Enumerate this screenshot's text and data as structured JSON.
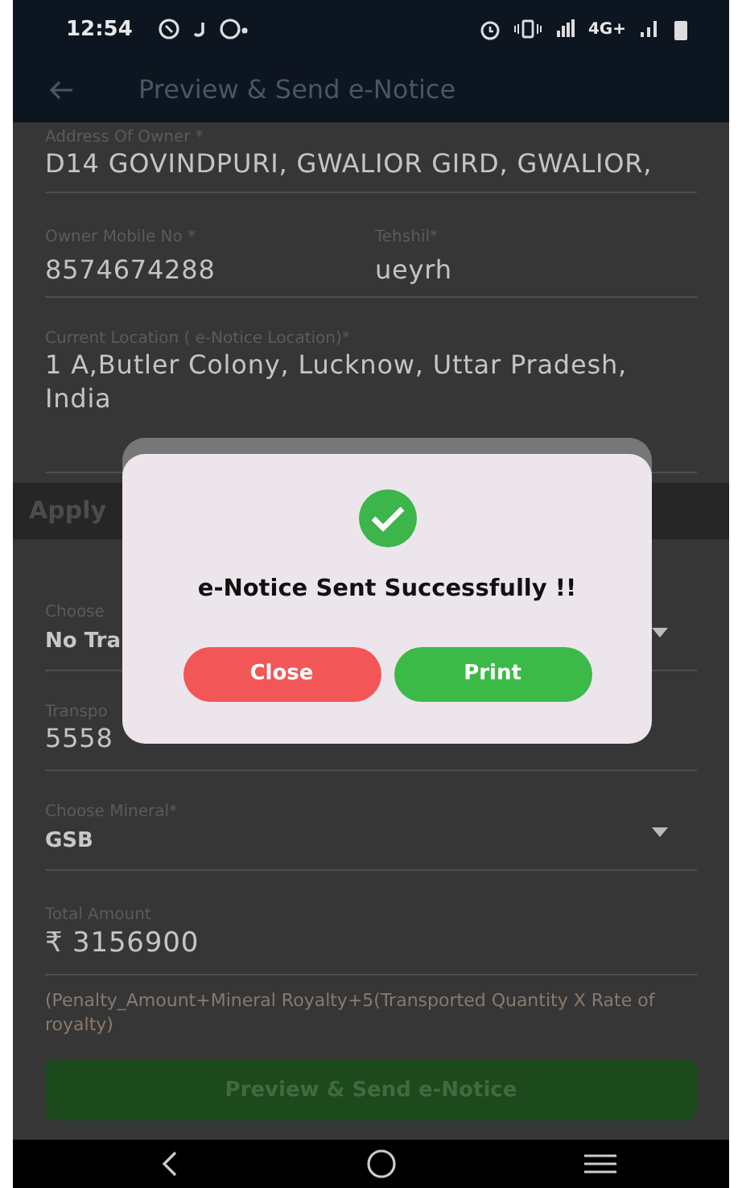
{
  "status_bar": {
    "time": "12:54",
    "network": "4G+"
  },
  "app_bar": {
    "title": "Preview & Send e-Notice"
  },
  "owner_fields": [
    {
      "kind": "text",
      "label": "Address Of Owner *",
      "value": "D14 GOVINDPURI, GWALIOR GIRD, GWALIOR,"
    },
    {
      "kind": "pair",
      "items": [
        {
          "label": "Owner Mobile No *",
          "value": "8574674288"
        },
        {
          "label": "Tehshil*",
          "value": "ueyrh"
        }
      ]
    },
    {
      "kind": "tall",
      "label": "Current Location ( e-Notice Location)*",
      "value": "1 A,Butler Colony, Lucknow, Uttar Pradesh, India"
    }
  ],
  "section": {
    "title": "Apply"
  },
  "violation_fields": [
    {
      "kind": "select",
      "label": "Choose",
      "value": "No Tra"
    },
    {
      "kind": "text",
      "label": "Transpo",
      "value": "5558"
    },
    {
      "kind": "select",
      "label": "Choose Mineral*",
      "value": "GSB"
    },
    {
      "kind": "amount",
      "label": "Total Amount",
      "value": "₹ 3156900"
    }
  ],
  "formula_note": "(Penalty_Amount+Mineral Royalty+5(Transported Quantity X Rate of royalty)",
  "submit_button": "Preview & Send e-Notice",
  "dialog": {
    "message": "e-Notice Sent Successfully !!",
    "buttons": [
      {
        "label": "Close",
        "kind": "danger"
      },
      {
        "label": "Print",
        "kind": "success"
      }
    ]
  }
}
